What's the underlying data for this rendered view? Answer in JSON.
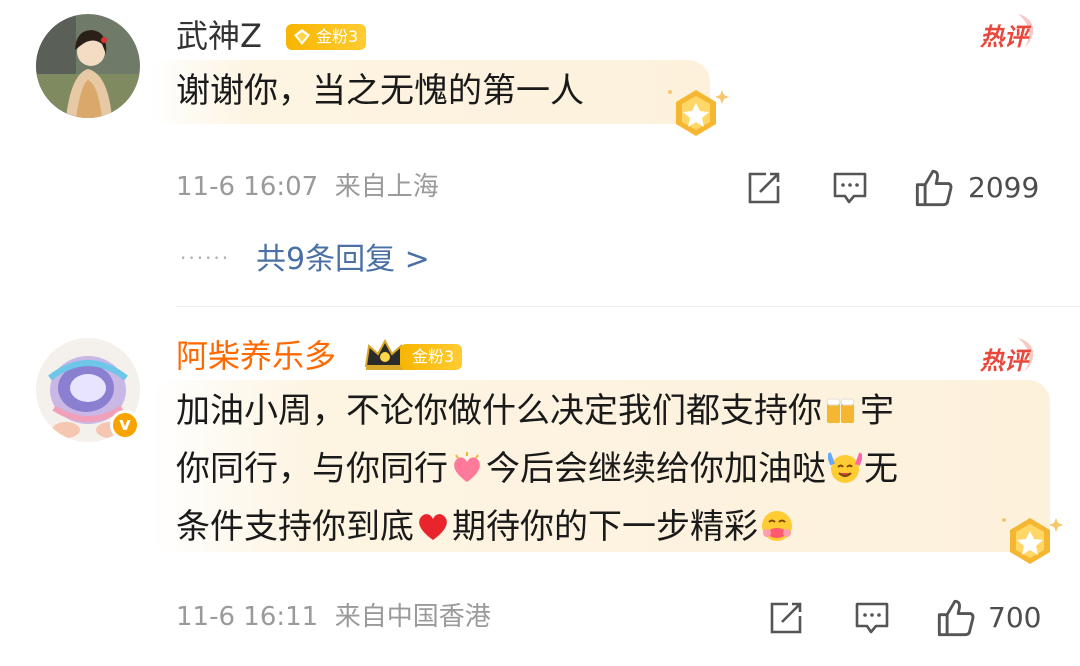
{
  "comments": [
    {
      "username": "武神Z",
      "badge": "金粉3",
      "hot_label": "热评",
      "text": "谢谢你，当之无愧的第一人",
      "timestamp": "11-6 16:07",
      "location": "来自上海",
      "likes": "2099",
      "replies_link": "共9条回复 >",
      "replies_dots": "······"
    },
    {
      "username": "阿柴养乐多",
      "badge": "金粉3",
      "hot_label": "热评",
      "verified_mark": "v",
      "text_line1_a": "加油小周，不论你做什么决定我们都支持你",
      "text_line1_b": "宇",
      "text_line2_a": "你同行，与你同行",
      "text_line2_b": "今后会继续给你加油哒",
      "text_line2_c": "无",
      "text_line3_a": "条件支持你到底",
      "text_line3_b": "期待你的下一步精彩",
      "timestamp": "11-6 16:11",
      "location": "来自中国香港",
      "likes": "700"
    }
  ],
  "colors": {
    "username_orange": "#ff6a00",
    "link_blue": "#4a70a6",
    "meta_gray": "#9a9a9a",
    "hot_red": "#e8483b",
    "badge_gold": "#f7b500"
  },
  "icons": [
    "repost-icon",
    "comment-icon",
    "like-icon",
    "hot-comment-icon",
    "gold-medal-icon",
    "crown-icon",
    "beer-emoji",
    "heart-emoji",
    "cheer-emoji",
    "red-heart-emoji",
    "hug-emoji"
  ]
}
